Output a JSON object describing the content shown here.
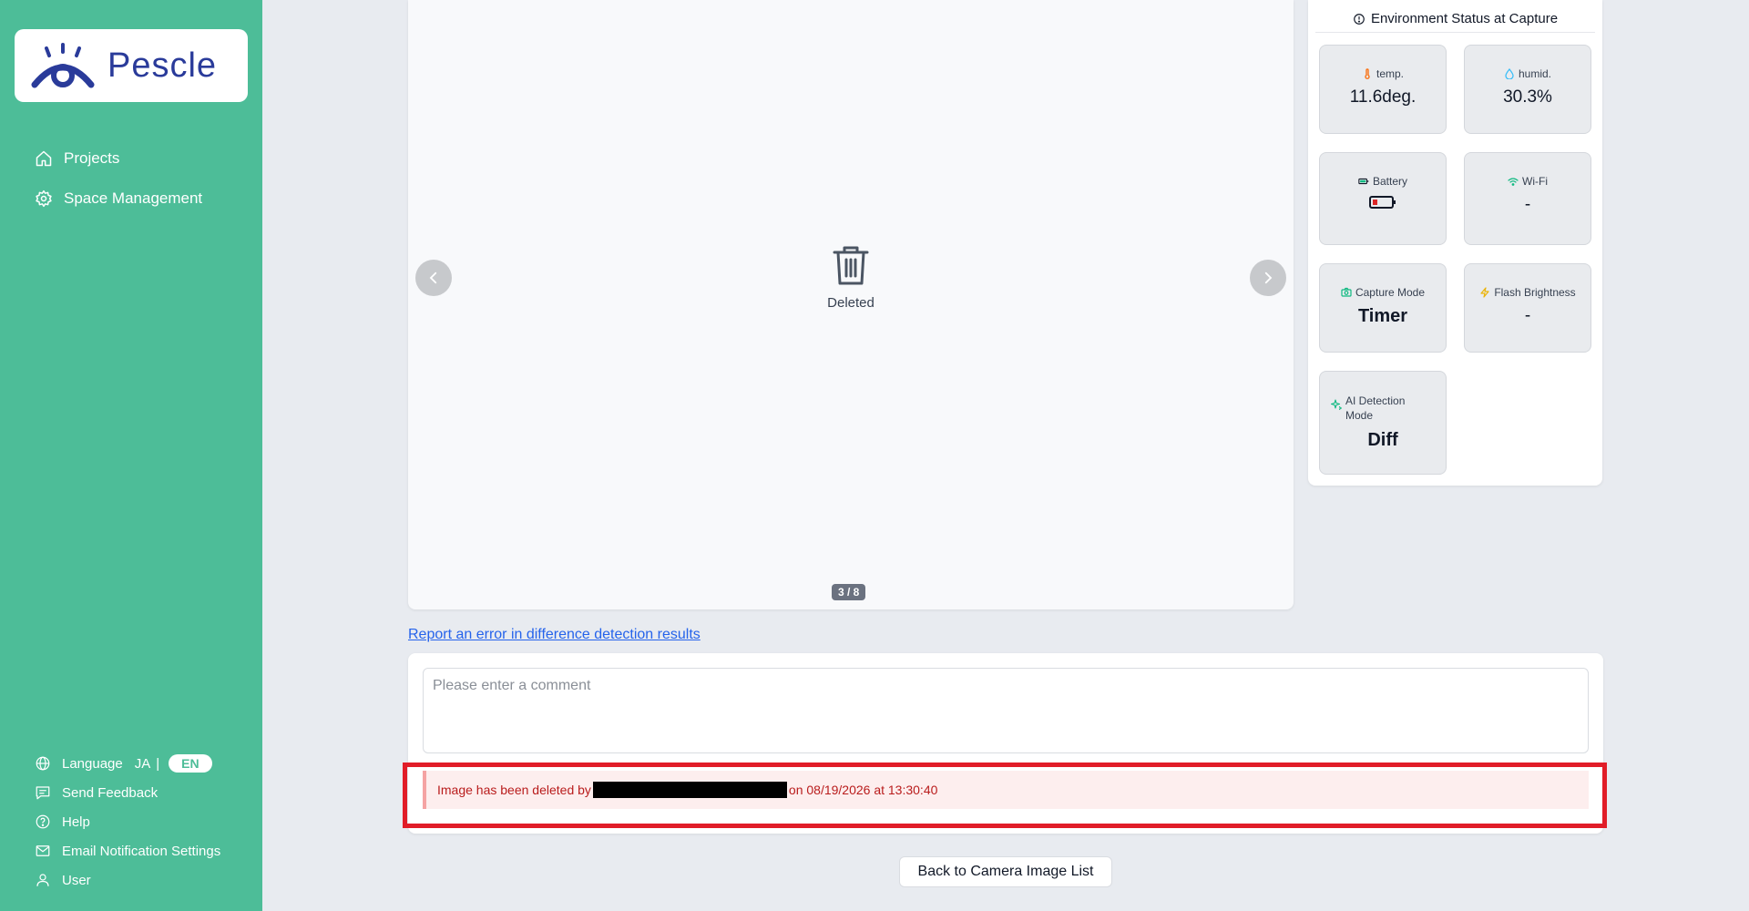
{
  "brand": {
    "name": "Pescle"
  },
  "sidebar": {
    "items": [
      {
        "label": "Projects",
        "icon": "home-icon"
      },
      {
        "label": "Space Management",
        "icon": "gear-icon"
      }
    ],
    "bottom": {
      "language_label": "Language",
      "lang_ja": "JA",
      "lang_sep": "|",
      "lang_en": "EN",
      "feedback": "Send Feedback",
      "help": "Help",
      "email_settings": "Email Notification Settings",
      "user": "User"
    }
  },
  "viewer": {
    "deleted_label": "Deleted",
    "counter": "3 / 8"
  },
  "environment": {
    "title": "Environment Status at Capture",
    "temp": {
      "label": "temp.",
      "value": "11.6deg."
    },
    "humid": {
      "label": "humid.",
      "value": "30.3%"
    },
    "battery": {
      "label": "Battery",
      "level": "low"
    },
    "wifi": {
      "label": "Wi-Fi",
      "value": "-"
    },
    "capture_mode": {
      "label": "Capture Mode",
      "value": "Timer"
    },
    "flash": {
      "label": "Flash Brightness",
      "value": "-"
    },
    "ai_mode": {
      "label": "AI Detection Mode",
      "value": "Diff"
    }
  },
  "report_link": "Report an error in difference detection results",
  "comment": {
    "placeholder": "Please enter a comment",
    "deleted_prefix": "Image has been deleted by",
    "deleted_suffix": "on 08/19/2026 at 13:30:40"
  },
  "back_button": "Back to Camera Image List",
  "colors": {
    "sidebar": "#4dbd98",
    "alert_text": "#b91c1c",
    "highlight": "#e11d28",
    "link": "#2563eb"
  }
}
